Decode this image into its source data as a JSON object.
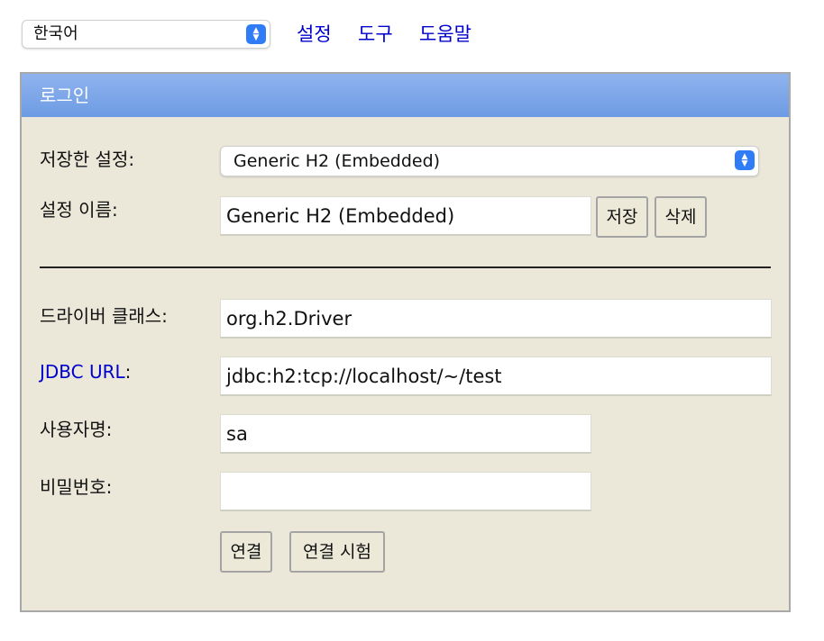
{
  "toolbar": {
    "language": "한국어",
    "links": [
      "설정",
      "도구",
      "도움말"
    ]
  },
  "panel": {
    "title": "로그인",
    "saved_settings_label": "저장한 설정:",
    "saved_settings_value": "Generic H2 (Embedded)",
    "setting_name_label": "설정 이름:",
    "setting_name_value": "Generic H2 (Embedded)",
    "save_button": "저장",
    "delete_button": "삭제",
    "driver_class_label": "드라이버 클래스:",
    "driver_class_value": "org.h2.Driver",
    "jdbc_url_label": "JDBC URL",
    "jdbc_url_colon": ":",
    "jdbc_url_value": "jdbc:h2:tcp://localhost/~/test",
    "username_label": "사용자명:",
    "username_value": "sa",
    "password_label": "비밀번호:",
    "password_value": "",
    "connect_button": "연결",
    "test_connection_button": "연결 시험"
  },
  "colors": {
    "link": "#0000cc",
    "panel_bg": "#ebe8da",
    "header_bg": "#7aa6e8",
    "select_accent": "#2f7cf6"
  }
}
